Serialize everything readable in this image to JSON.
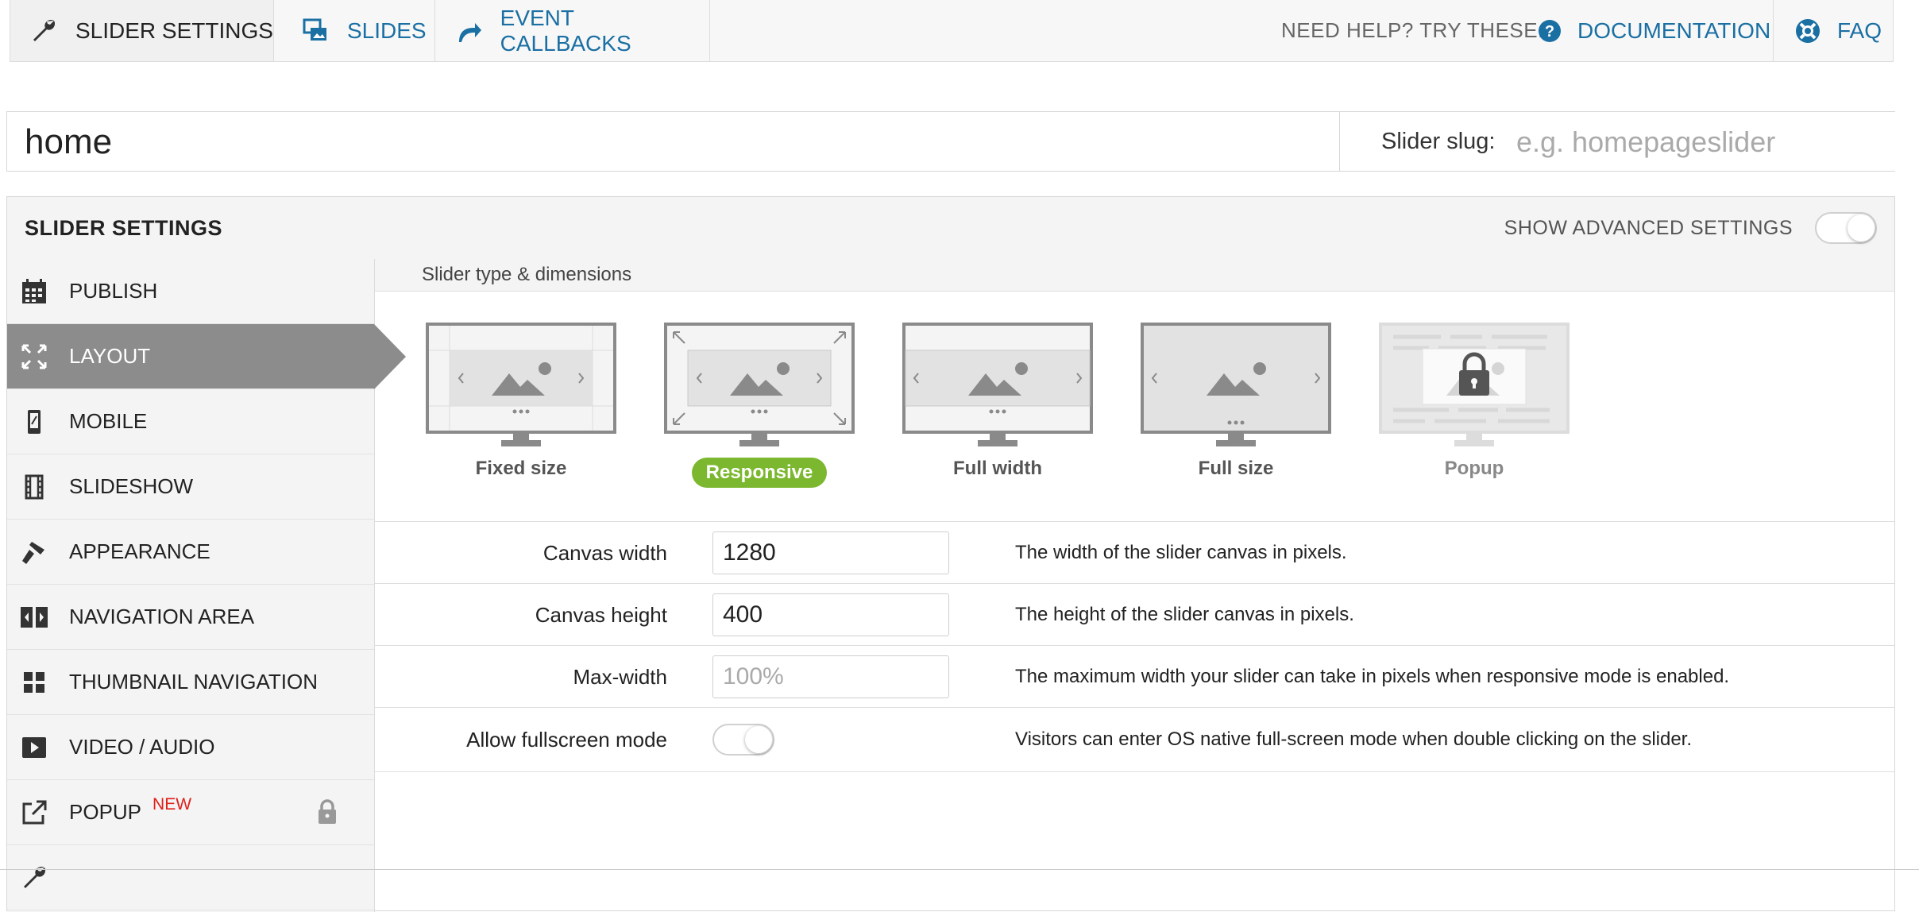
{
  "topbar": {
    "tabs": [
      {
        "label": "SLIDER SETTINGS",
        "icon": "wrench-icon",
        "active": true
      },
      {
        "label": "SLIDES",
        "icon": "slides-icon",
        "active": false
      },
      {
        "label": "EVENT CALLBACKS",
        "icon": "redo-arrow-icon",
        "active": false
      }
    ],
    "help_text": "NEED HELP? TRY THESE:",
    "documentation_label": "DOCUMENTATION",
    "faq_label": "FAQ"
  },
  "name_row": {
    "slider_name": "home",
    "slug_label": "Slider slug:",
    "slug_placeholder": "e.g. homepageslider"
  },
  "panel": {
    "title": "SLIDER SETTINGS",
    "advanced_label": "SHOW ADVANCED SETTINGS",
    "advanced_enabled": false
  },
  "sidebar": {
    "items": [
      {
        "label": "PUBLISH",
        "icon": "calendar-icon"
      },
      {
        "label": "LAYOUT",
        "icon": "resize-arrows-icon",
        "active": true
      },
      {
        "label": "MOBILE",
        "icon": "mobile-phone-icon"
      },
      {
        "label": "SLIDESHOW",
        "icon": "film-strip-icon"
      },
      {
        "label": "APPEARANCE",
        "icon": "brush-icon"
      },
      {
        "label": "NAVIGATION AREA",
        "icon": "navigation-arrows-icon"
      },
      {
        "label": "THUMBNAIL NAVIGATION",
        "icon": "grid-icon"
      },
      {
        "label": "VIDEO / AUDIO",
        "icon": "play-icon"
      },
      {
        "label": "POPUP",
        "icon": "external-link-icon",
        "badge": "NEW",
        "locked": true
      }
    ]
  },
  "layout": {
    "section_title": "Slider type & dimensions",
    "slider_types": [
      {
        "label": "Fixed size",
        "selected": false,
        "locked": false
      },
      {
        "label": "Responsive",
        "selected": true,
        "locked": false
      },
      {
        "label": "Full width",
        "selected": false,
        "locked": false
      },
      {
        "label": "Full size",
        "selected": false,
        "locked": false
      },
      {
        "label": "Popup",
        "selected": false,
        "locked": true
      }
    ],
    "fields": {
      "canvas_width": {
        "label": "Canvas width",
        "value": "1280",
        "help": "The width of the slider canvas in pixels."
      },
      "canvas_height": {
        "label": "Canvas height",
        "value": "400",
        "help": "The height of the slider canvas in pixels."
      },
      "max_width": {
        "label": "Max-width",
        "placeholder": "100%",
        "help": "The maximum width your slider can take in pixels when responsive mode is enabled."
      },
      "fullscreen": {
        "label": "Allow fullscreen mode",
        "enabled": false,
        "help": "Visitors can enter OS native full-screen mode when double clicking on the slider."
      }
    }
  },
  "colors": {
    "link": "#1a6fa3",
    "active_nav": "#8c8c8c",
    "selected_pill": "#7cb82f",
    "new_badge": "#e0201a"
  }
}
